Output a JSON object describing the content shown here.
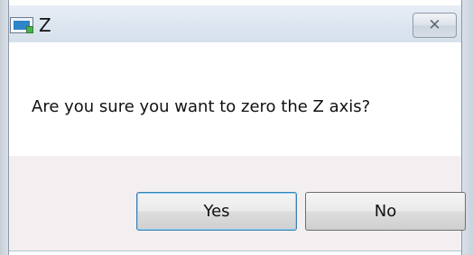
{
  "window": {
    "title": "Z",
    "close_glyph": "✕"
  },
  "dialog": {
    "message": "Are you sure you want to zero the Z axis?"
  },
  "buttons": {
    "yes_label": "Yes",
    "no_label": "No"
  },
  "icons": {
    "app": "app-window-icon",
    "close": "close-icon"
  }
}
